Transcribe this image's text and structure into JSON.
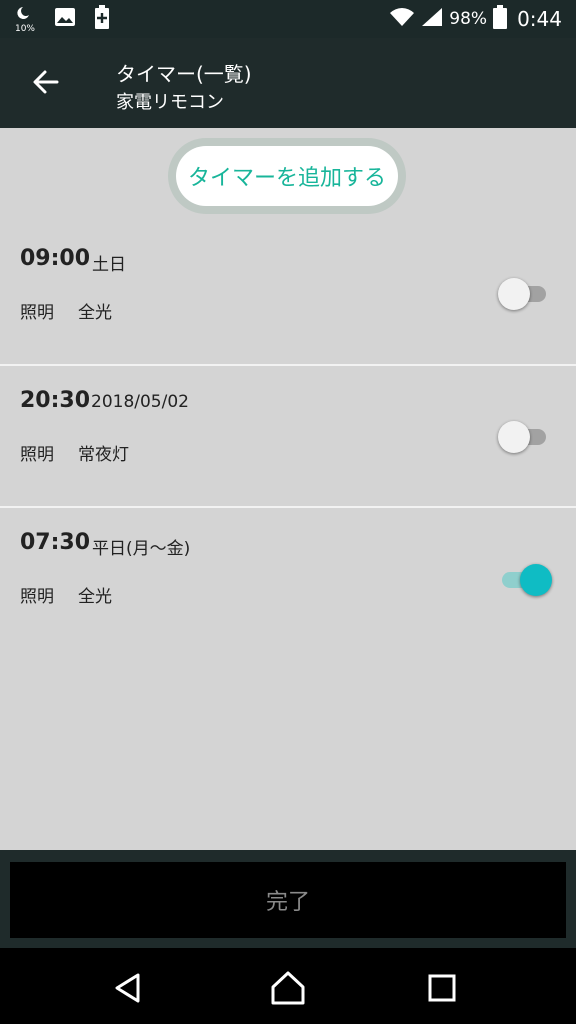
{
  "status_bar": {
    "battery_small": "10%",
    "battery_percent": "98%",
    "time": "0:44",
    "icons": [
      "moon-battery-icon",
      "image-icon",
      "battery-plus-icon",
      "wifi-icon",
      "signal-icon",
      "battery-icon"
    ]
  },
  "app_bar": {
    "title": "タイマー(一覧)",
    "subtitle": "家電リモコン"
  },
  "add_button_label": "タイマーを追加する",
  "timers": [
    {
      "time": "09:00",
      "schedule": "土日",
      "device": "照明",
      "mode": "全光",
      "enabled": false
    },
    {
      "time": "20:30",
      "schedule": "2018/05/02",
      "device": "照明",
      "mode": "常夜灯",
      "enabled": false
    },
    {
      "time": "07:30",
      "schedule": "平日(月〜金)",
      "device": "照明",
      "mode": "全光",
      "enabled": true
    }
  ],
  "done_button_label": "完了",
  "colors": {
    "accent": "#0fbcc4",
    "add_text": "#18b59a",
    "app_bar": "#1f2b2b",
    "background": "#d4d4d4"
  }
}
